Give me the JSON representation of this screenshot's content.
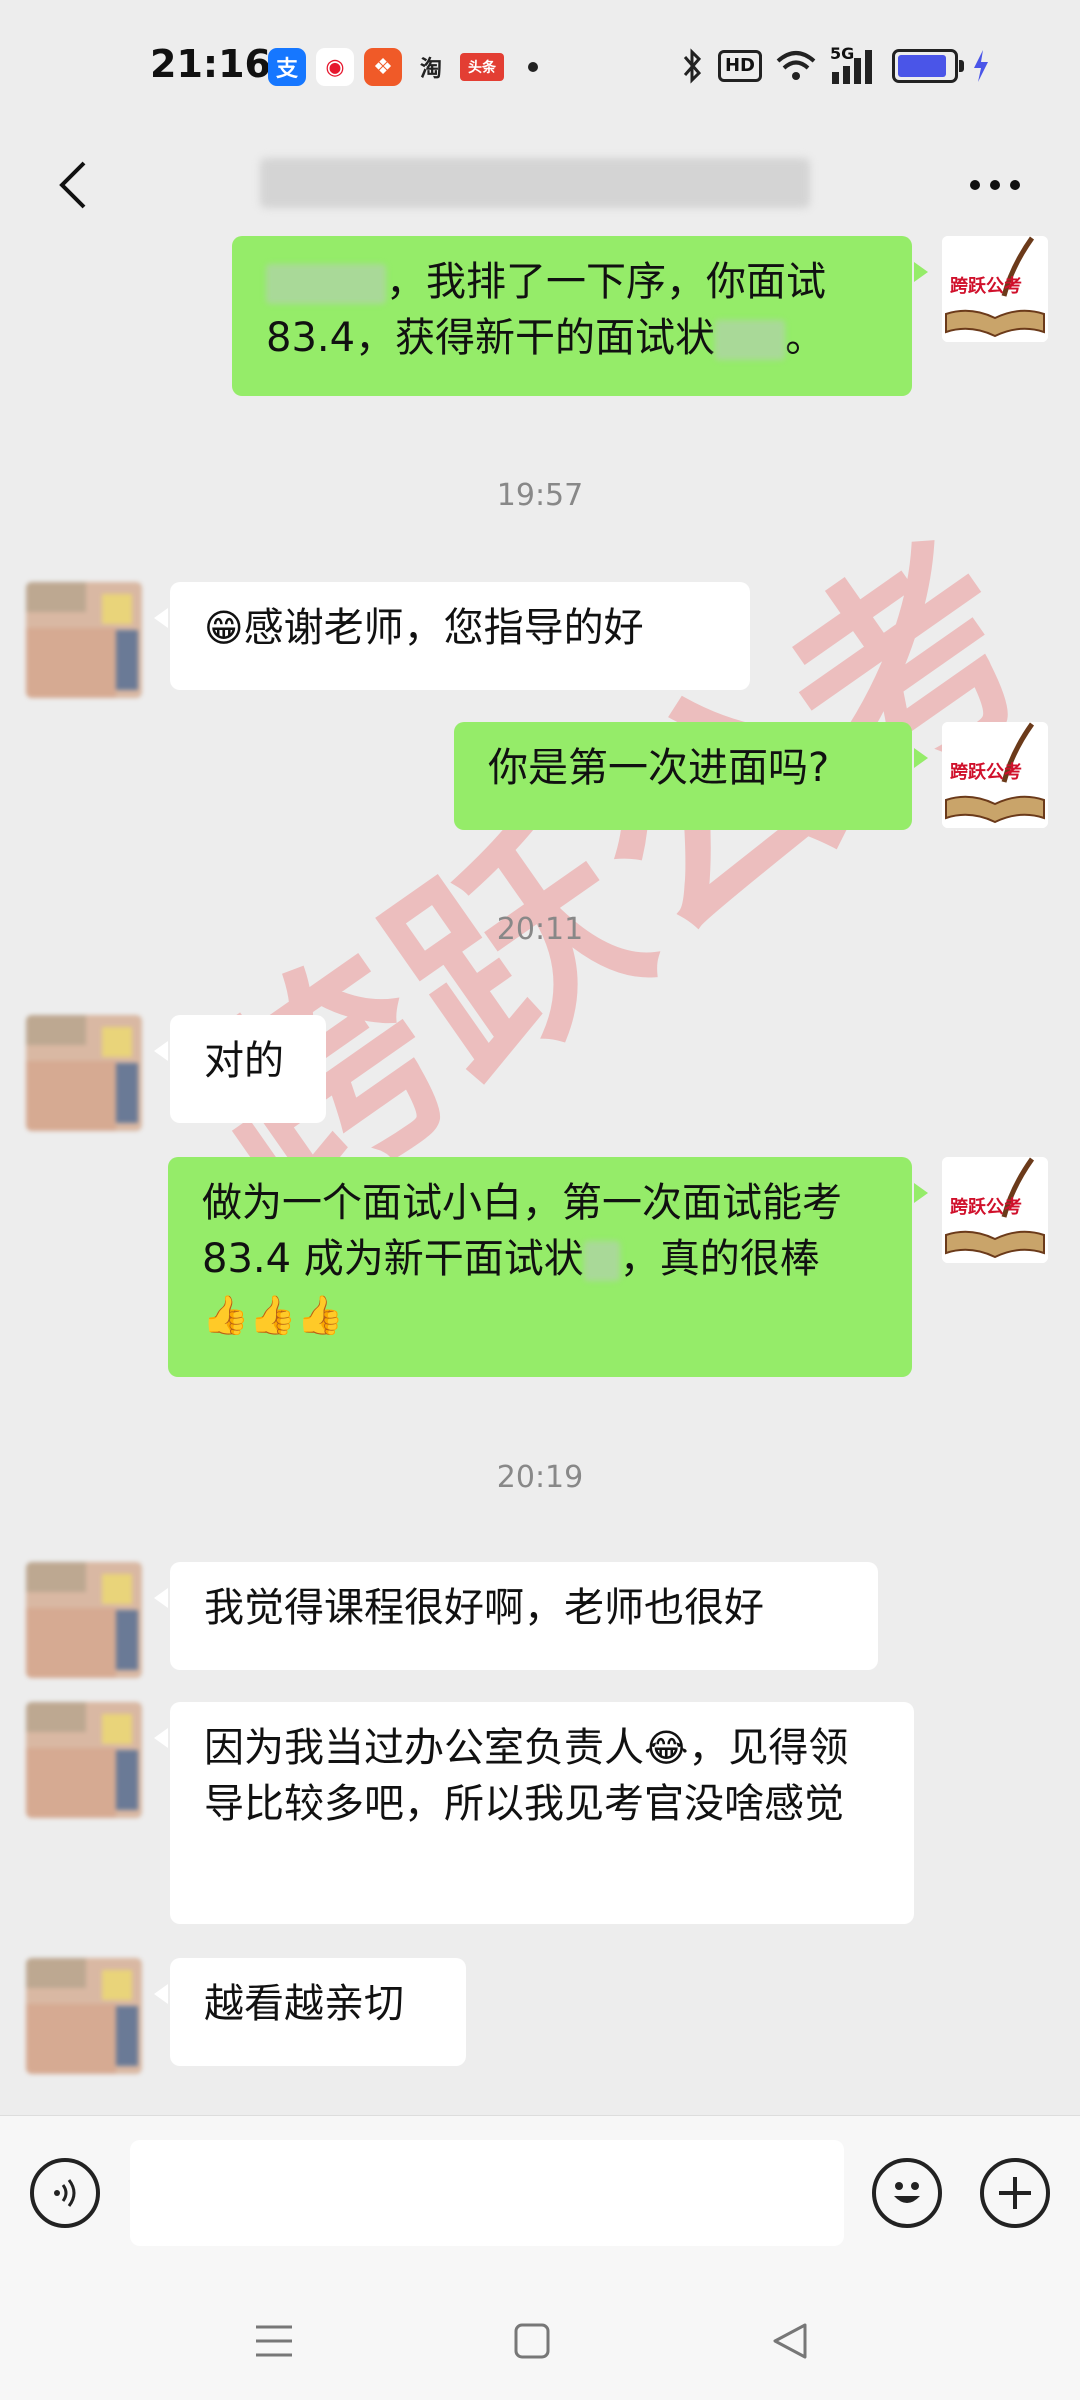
{
  "status_bar": {
    "time": "21:16",
    "app_icons": [
      {
        "name": "alipay-icon",
        "glyph": "支",
        "color": "#1677ff"
      },
      {
        "name": "weibo-icon",
        "glyph": "微",
        "color": "#f5a623"
      },
      {
        "name": "xinhua-icon",
        "glyph": "文",
        "color": "#f05a28"
      },
      {
        "name": "taobao-icon",
        "glyph": "淘",
        "color": "#ffffff"
      },
      {
        "name": "toutiao-icon",
        "glyph": "头条",
        "color": "#e33e33"
      }
    ],
    "hd_label": "HD",
    "network_label": "5G"
  },
  "header": {
    "back_label": "‹",
    "more_label": "···"
  },
  "messages": [
    {
      "side": "me",
      "text": "，我排了一下序，你面试83.4，获得新干的面试状"
    },
    {
      "timestamp": "19:57"
    },
    {
      "side": "other",
      "text": "感谢老师，您指导的好"
    },
    {
      "side": "me",
      "text": "你是第一次进面吗?"
    },
    {
      "timestamp": "20:11"
    },
    {
      "side": "other",
      "text": "对的"
    },
    {
      "side": "me",
      "text": "做为一个面试小白，第一次面试能考 83.4 成为新干面试状"
    },
    {
      "side": "me",
      "text_tail": "，真的很棒"
    },
    {
      "timestamp": "20:19"
    },
    {
      "side": "other",
      "text": "我觉得课程很好啊，老师也很好"
    },
    {
      "side": "other",
      "text": "因为我当过办公室负责人"
    },
    {
      "side": "other",
      "text_tail": "，见得领导比较多吧，所以我见考官没啥感觉"
    },
    {
      "side": "other",
      "text": "越看越亲切"
    }
  ],
  "avatar_me_label": "跨跃公考",
  "watermark": "跨跃公考",
  "input": {
    "placeholder": ""
  },
  "colors": {
    "my_bubble": "#95ec69",
    "other_bubble": "#ffffff",
    "background": "#ededed"
  }
}
